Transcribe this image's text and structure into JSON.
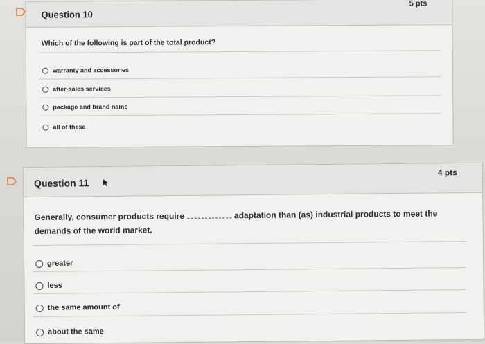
{
  "questions": [
    {
      "title": "Question 10",
      "points": "5 pts",
      "text": "Which of the following is part of the total product?",
      "answers": [
        "warranty and accessories",
        "after-sales services",
        "package and brand name",
        "all of these"
      ]
    },
    {
      "title": "Question 11",
      "points": "4 pts",
      "text_before": "Generally, consumer products require",
      "text_after": "adaptation than (as) industrial products to meet the demands of the world market.",
      "answers": [
        "greater",
        "less",
        "the same amount of",
        "about the same"
      ]
    }
  ],
  "icons": {
    "flag": "flag-icon",
    "cursor": "cursor-arrow-icon",
    "radio": "radio-button-icon"
  },
  "colors": {
    "background": "#d9d9d6",
    "panel": "#f1f1ef",
    "header": "#e4e4e2",
    "text": "#2d2d2d"
  }
}
